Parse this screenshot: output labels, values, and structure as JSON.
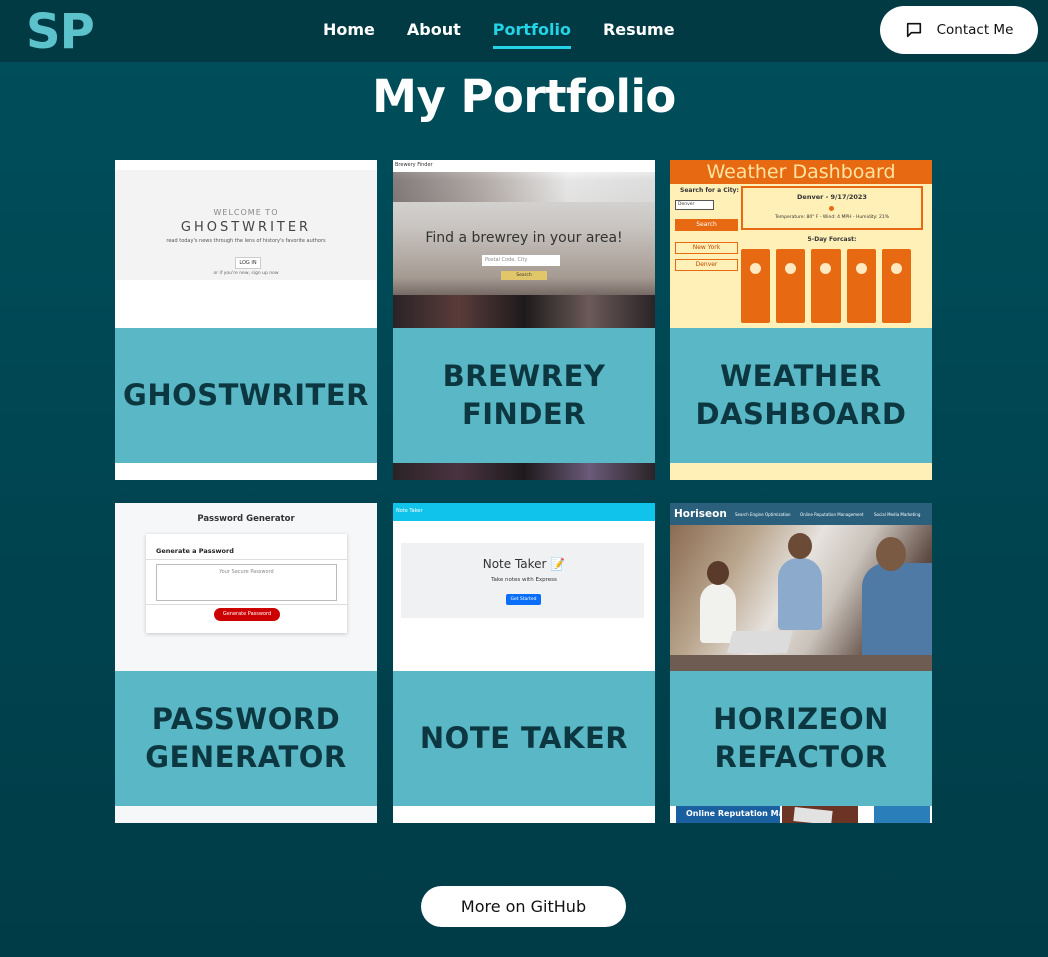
{
  "nav": {
    "logo": "SP",
    "links": [
      "Home",
      "About",
      "Portfolio",
      "Resume"
    ],
    "active": "Portfolio",
    "contact_label": "Contact Me",
    "contact_icon": "chat-icon"
  },
  "page_title": "My Portfolio",
  "projects": [
    {
      "title": "GHOSTWRITER",
      "preview": {
        "welcome": "WELCOME TO",
        "brand": "GHOSTWRITER",
        "tagline": "read today's news through the lens of history's favorite authors",
        "login": "LOG IN",
        "signup": "or if you're new, sign up now"
      }
    },
    {
      "title": "BREWREY\nFINDER",
      "preview": {
        "app_name": "Brewery Finder",
        "headline": "Find a brewrey in your area!",
        "input_placeholder": "Postal Code, City",
        "button": "Search"
      }
    },
    {
      "title": "WEATHER\nDASHBOARD",
      "preview": {
        "header": "Weather Dashboard",
        "search_label": "Search for a City:",
        "input_value": "Denver",
        "search_button": "Search",
        "history": [
          "New York",
          "Denver"
        ],
        "current_city": "Denver - 9/17/2023",
        "current_stats": "Temperature: 80° F - Wind: 4 MPH - Humidity: 21%",
        "forecast_title": "5-Day Forcast:"
      }
    },
    {
      "title": "PASSWORD\nGENERATOR",
      "preview": {
        "header": "Password Generator",
        "card_title": "Generate a Password",
        "placeholder": "Your Secure Password",
        "button": "Generate Password"
      }
    },
    {
      "title": "NOTE TAKER",
      "preview": {
        "app_name": "Note Taker",
        "headline": "Note Taker 📝",
        "subtext": "Take notes with Express",
        "button": "Get Started"
      }
    },
    {
      "title": "HORIZEON\nREFACTOR",
      "preview": {
        "brand": "Horiseon",
        "nav": [
          "Search Engine Optimization",
          "Online Reputation Management",
          "Social Media Marketing"
        ],
        "footer_label": "Online Reputation Management"
      }
    }
  ],
  "github_label": "More on GitHub",
  "colors": {
    "background": "#004b57",
    "nav_bg": "#023a44",
    "accent": "#23d3e6",
    "logo": "#5cc3cc",
    "card_band": "#5ab7c5",
    "card_text": "#0c3740"
  }
}
